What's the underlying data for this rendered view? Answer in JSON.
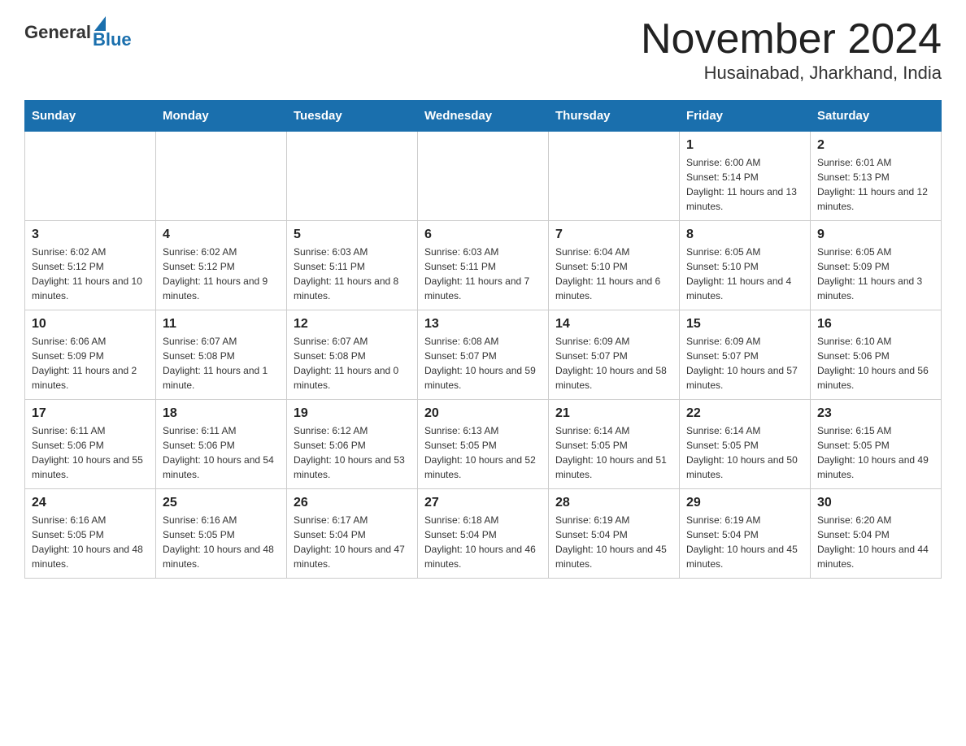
{
  "logo": {
    "general": "General",
    "blue": "Blue"
  },
  "title": "November 2024",
  "subtitle": "Husainabad, Jharkhand, India",
  "days_of_week": [
    "Sunday",
    "Monday",
    "Tuesday",
    "Wednesday",
    "Thursday",
    "Friday",
    "Saturday"
  ],
  "weeks": [
    [
      {
        "day": "",
        "info": ""
      },
      {
        "day": "",
        "info": ""
      },
      {
        "day": "",
        "info": ""
      },
      {
        "day": "",
        "info": ""
      },
      {
        "day": "",
        "info": ""
      },
      {
        "day": "1",
        "info": "Sunrise: 6:00 AM\nSunset: 5:14 PM\nDaylight: 11 hours and 13 minutes."
      },
      {
        "day": "2",
        "info": "Sunrise: 6:01 AM\nSunset: 5:13 PM\nDaylight: 11 hours and 12 minutes."
      }
    ],
    [
      {
        "day": "3",
        "info": "Sunrise: 6:02 AM\nSunset: 5:12 PM\nDaylight: 11 hours and 10 minutes."
      },
      {
        "day": "4",
        "info": "Sunrise: 6:02 AM\nSunset: 5:12 PM\nDaylight: 11 hours and 9 minutes."
      },
      {
        "day": "5",
        "info": "Sunrise: 6:03 AM\nSunset: 5:11 PM\nDaylight: 11 hours and 8 minutes."
      },
      {
        "day": "6",
        "info": "Sunrise: 6:03 AM\nSunset: 5:11 PM\nDaylight: 11 hours and 7 minutes."
      },
      {
        "day": "7",
        "info": "Sunrise: 6:04 AM\nSunset: 5:10 PM\nDaylight: 11 hours and 6 minutes."
      },
      {
        "day": "8",
        "info": "Sunrise: 6:05 AM\nSunset: 5:10 PM\nDaylight: 11 hours and 4 minutes."
      },
      {
        "day": "9",
        "info": "Sunrise: 6:05 AM\nSunset: 5:09 PM\nDaylight: 11 hours and 3 minutes."
      }
    ],
    [
      {
        "day": "10",
        "info": "Sunrise: 6:06 AM\nSunset: 5:09 PM\nDaylight: 11 hours and 2 minutes."
      },
      {
        "day": "11",
        "info": "Sunrise: 6:07 AM\nSunset: 5:08 PM\nDaylight: 11 hours and 1 minute."
      },
      {
        "day": "12",
        "info": "Sunrise: 6:07 AM\nSunset: 5:08 PM\nDaylight: 11 hours and 0 minutes."
      },
      {
        "day": "13",
        "info": "Sunrise: 6:08 AM\nSunset: 5:07 PM\nDaylight: 10 hours and 59 minutes."
      },
      {
        "day": "14",
        "info": "Sunrise: 6:09 AM\nSunset: 5:07 PM\nDaylight: 10 hours and 58 minutes."
      },
      {
        "day": "15",
        "info": "Sunrise: 6:09 AM\nSunset: 5:07 PM\nDaylight: 10 hours and 57 minutes."
      },
      {
        "day": "16",
        "info": "Sunrise: 6:10 AM\nSunset: 5:06 PM\nDaylight: 10 hours and 56 minutes."
      }
    ],
    [
      {
        "day": "17",
        "info": "Sunrise: 6:11 AM\nSunset: 5:06 PM\nDaylight: 10 hours and 55 minutes."
      },
      {
        "day": "18",
        "info": "Sunrise: 6:11 AM\nSunset: 5:06 PM\nDaylight: 10 hours and 54 minutes."
      },
      {
        "day": "19",
        "info": "Sunrise: 6:12 AM\nSunset: 5:06 PM\nDaylight: 10 hours and 53 minutes."
      },
      {
        "day": "20",
        "info": "Sunrise: 6:13 AM\nSunset: 5:05 PM\nDaylight: 10 hours and 52 minutes."
      },
      {
        "day": "21",
        "info": "Sunrise: 6:14 AM\nSunset: 5:05 PM\nDaylight: 10 hours and 51 minutes."
      },
      {
        "day": "22",
        "info": "Sunrise: 6:14 AM\nSunset: 5:05 PM\nDaylight: 10 hours and 50 minutes."
      },
      {
        "day": "23",
        "info": "Sunrise: 6:15 AM\nSunset: 5:05 PM\nDaylight: 10 hours and 49 minutes."
      }
    ],
    [
      {
        "day": "24",
        "info": "Sunrise: 6:16 AM\nSunset: 5:05 PM\nDaylight: 10 hours and 48 minutes."
      },
      {
        "day": "25",
        "info": "Sunrise: 6:16 AM\nSunset: 5:05 PM\nDaylight: 10 hours and 48 minutes."
      },
      {
        "day": "26",
        "info": "Sunrise: 6:17 AM\nSunset: 5:04 PM\nDaylight: 10 hours and 47 minutes."
      },
      {
        "day": "27",
        "info": "Sunrise: 6:18 AM\nSunset: 5:04 PM\nDaylight: 10 hours and 46 minutes."
      },
      {
        "day": "28",
        "info": "Sunrise: 6:19 AM\nSunset: 5:04 PM\nDaylight: 10 hours and 45 minutes."
      },
      {
        "day": "29",
        "info": "Sunrise: 6:19 AM\nSunset: 5:04 PM\nDaylight: 10 hours and 45 minutes."
      },
      {
        "day": "30",
        "info": "Sunrise: 6:20 AM\nSunset: 5:04 PM\nDaylight: 10 hours and 44 minutes."
      }
    ]
  ]
}
